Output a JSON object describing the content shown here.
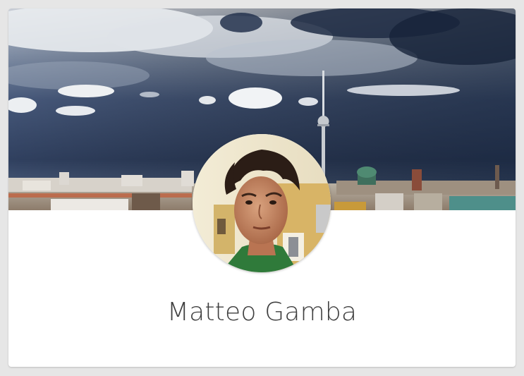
{
  "profile": {
    "name": "Matteo Gamba"
  },
  "colors": {
    "background": "#e6e6e6",
    "card": "#ffffff",
    "name_text": "#3f3f3f",
    "sky_dark": "#2f3e58",
    "sky_light": "#dfe4ea"
  },
  "images": {
    "cover": "city-skyline-with-tv-tower-photo",
    "avatar": "portrait-photo"
  }
}
